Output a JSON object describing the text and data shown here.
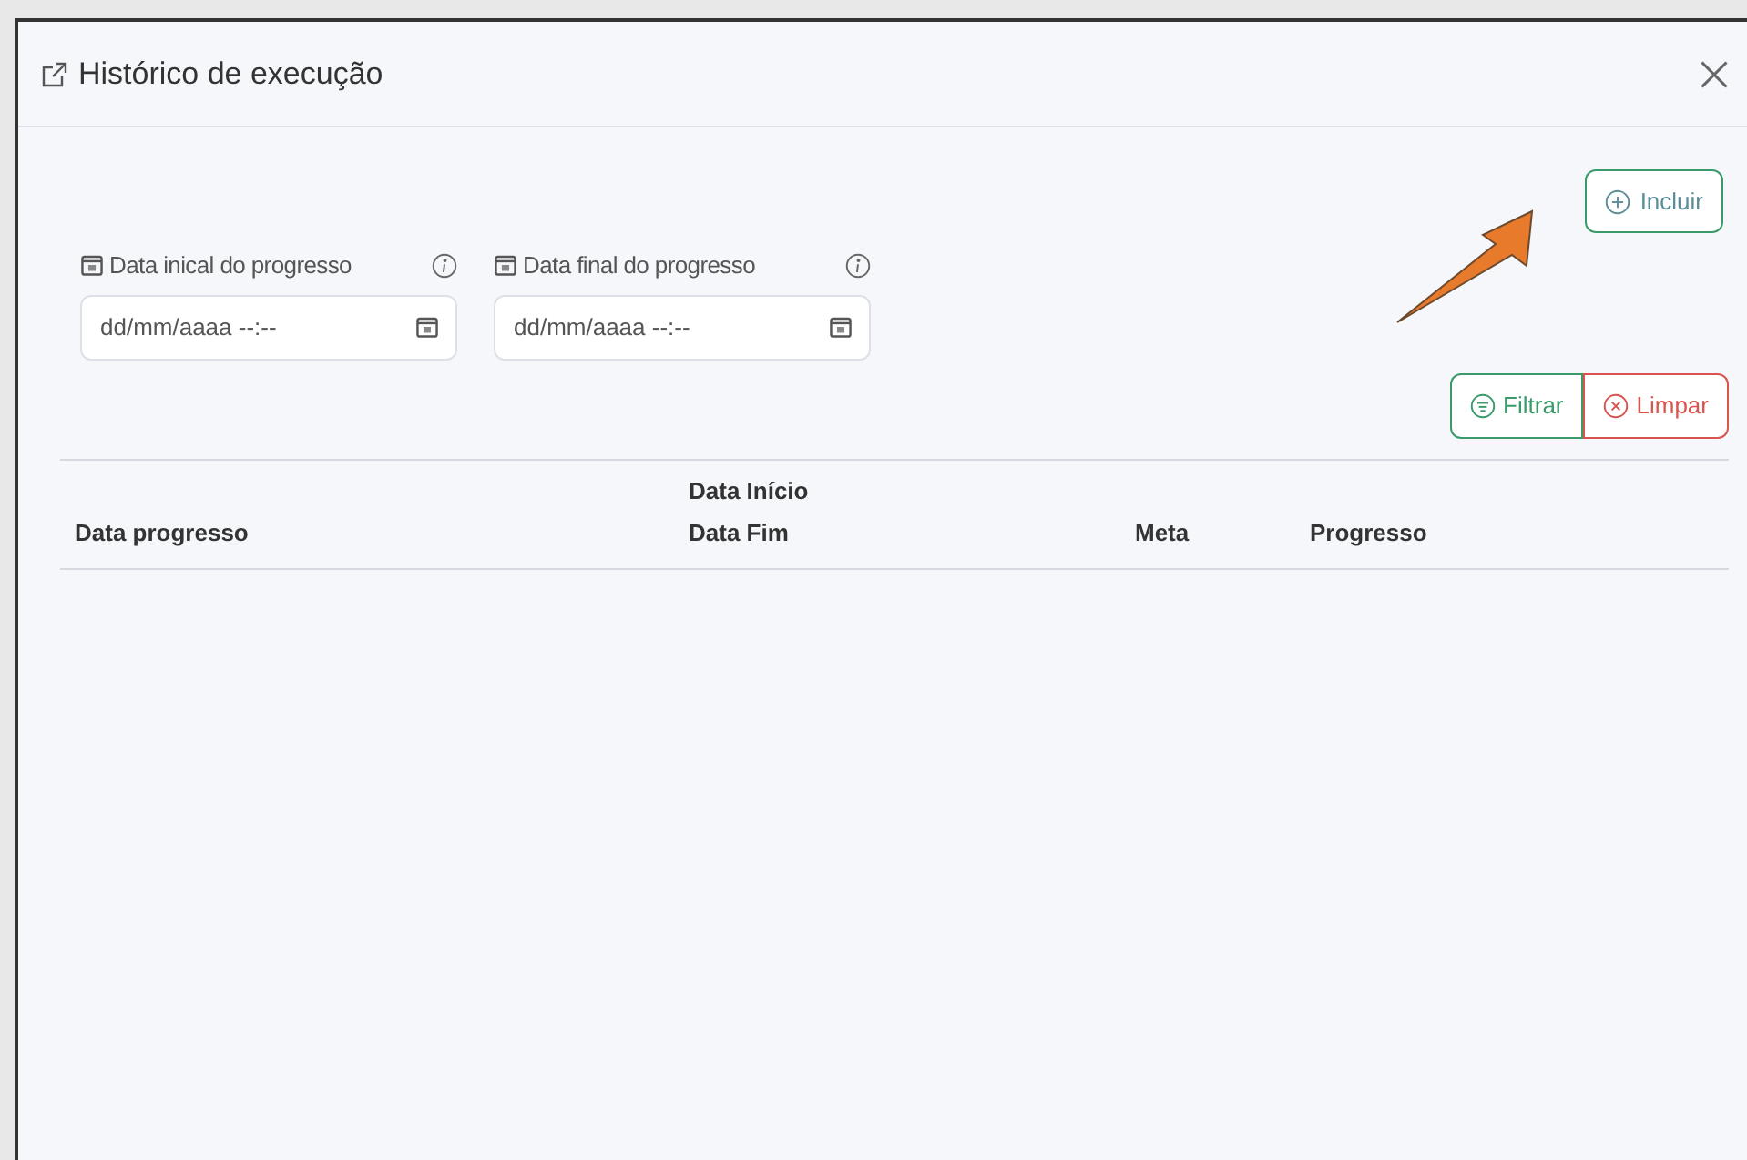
{
  "dialog": {
    "title": "Histórico de execução"
  },
  "actions": {
    "add_button": "Incluir"
  },
  "filters": [
    {
      "label": "Data inical do progresso",
      "placeholder": "dd/mm/aaaa --:--"
    },
    {
      "label": "Data final do progresso",
      "placeholder": "dd/mm/aaaa --:--"
    }
  ],
  "filter_buttons": [
    {
      "kind": "filter",
      "label": "Filtrar"
    },
    {
      "kind": "clear",
      "label": "Limpar"
    }
  ],
  "table": {
    "columns": [
      {
        "lines": [
          "Data progresso"
        ]
      },
      {
        "lines": [
          "Data Início",
          "Data Fim"
        ]
      },
      {
        "lines": [
          "Meta"
        ]
      },
      {
        "lines": [
          "Progresso"
        ]
      }
    ]
  }
}
